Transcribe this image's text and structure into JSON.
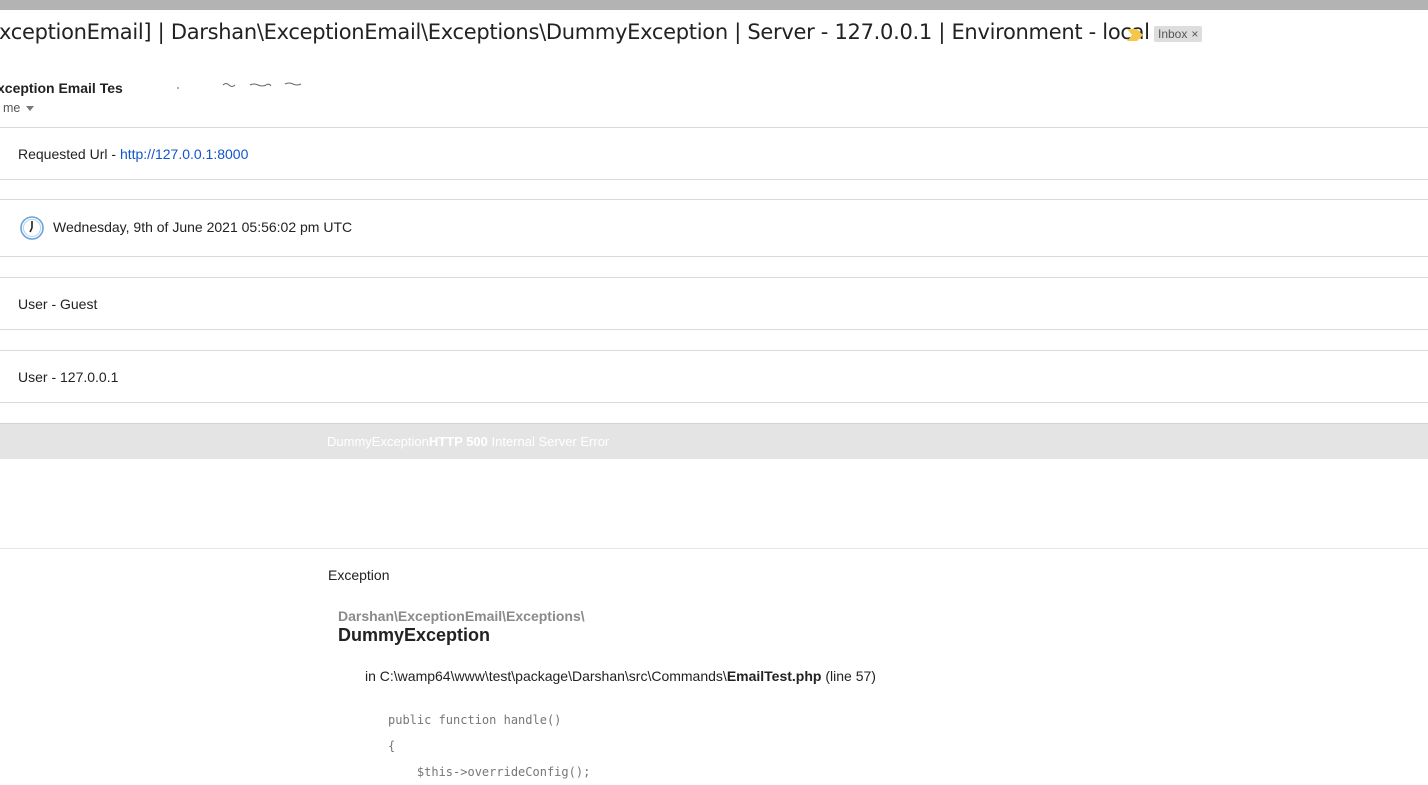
{
  "email": {
    "subject": "ExceptionEmail] | Darshan\\ExceptionEmail\\Exceptions\\DummyException | Server - 127.0.0.1 | Environment - local",
    "label_chip": "Inbox",
    "label_chip_close": "×",
    "sender_name": "xception Email Tes",
    "recipient": "me"
  },
  "details": {
    "requested_url_label": "Requested Url - ",
    "requested_url_link": "http://127.0.0.1:8000",
    "datetime": "Wednesday, 9th of June 2021 05:56:02 pm UTC",
    "user": "User - Guest",
    "user_ip": "User - 127.0.0.1"
  },
  "error_bar": {
    "exception_name": "DummyException",
    "http_code": "HTTP 500",
    "status_text": " Internal Server Error"
  },
  "exception": {
    "heading": "Exception",
    "namespace": "Darshan\\ExceptionEmail\\Exceptions\\",
    "class_name": "DummyException",
    "file_prefix": "in C:\\wamp64\\www\\test\\package\\Darshan\\src\\Commands\\",
    "file_name": "EmailTest.php",
    "file_line": " (line 57)",
    "code_lines": [
      "public function handle()",
      "{",
      "    $this->overrideConfig();"
    ]
  },
  "colors": {
    "link": "#1155cc",
    "important_marker": "#f4c74a",
    "error_bar_bg": "#e4e4e4",
    "chip_bg": "#dddddd"
  },
  "icons": [
    "important-marker-icon",
    "chevron-down-icon",
    "clock-icon",
    "close-icon"
  ]
}
